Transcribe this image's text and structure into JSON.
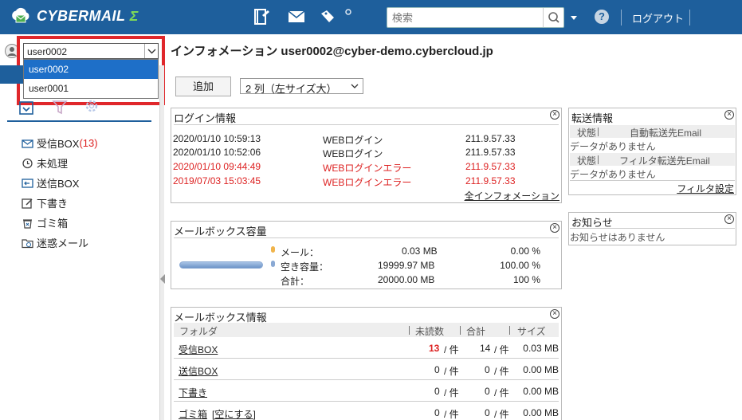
{
  "header": {
    "logo_text": "CYBERMAIL",
    "logo_sigma": "Σ",
    "search_placeholder": "検索",
    "help_label": "?",
    "logout_label": "ログアウト",
    "accent_color": "#1e5f9c"
  },
  "account": {
    "selected": "user0002",
    "options": [
      "user0002",
      "user0001"
    ]
  },
  "page_title": "インフォメーション user0002@cyber-demo.cybercloud.jp",
  "sidebar": {
    "folders": [
      {
        "label": "受信BOX",
        "count": "(13)",
        "icon": "inbox-icon"
      },
      {
        "label": "未処理",
        "count": "",
        "icon": "clock-icon"
      },
      {
        "label": "送信BOX",
        "count": "",
        "icon": "outbox-icon"
      },
      {
        "label": "下書き",
        "count": "",
        "icon": "draft-icon"
      },
      {
        "label": "ゴミ箱",
        "count": "",
        "icon": "trash-icon"
      },
      {
        "label": "迷惑メール",
        "count": "",
        "icon": "spam-folder-icon"
      }
    ]
  },
  "toolbar": {
    "add_label": "追加",
    "layout_value": "2 列（左サイズ大）"
  },
  "login_panel": {
    "title": "ログイン情報",
    "rows": [
      {
        "time": "2020/01/10 10:59:13",
        "event": "WEBログイン",
        "ip": "211.9.57.33",
        "error": false
      },
      {
        "time": "2020/01/10 10:52:06",
        "event": "WEBログイン",
        "ip": "211.9.57.33",
        "error": false
      },
      {
        "time": "2020/01/10 09:44:49",
        "event": "WEBログインエラー",
        "ip": "211.9.57.33",
        "error": true
      },
      {
        "time": "2019/07/03 15:03:45",
        "event": "WEBログインエラー",
        "ip": "211.9.57.33",
        "error": true
      }
    ],
    "all_link": "全インフォメーション"
  },
  "capacity_panel": {
    "title": "メールボックス容量",
    "used_fraction": 0.0,
    "rows": [
      {
        "label": "メール：",
        "size": "0.03 MB",
        "pct": "0.00 %",
        "dot_color": "#f0b44c"
      },
      {
        "label": "空き容量：",
        "size": "19999.97 MB",
        "pct": "100.00 %",
        "dot_color": "#8aa9d4"
      },
      {
        "label": "合計：",
        "size": "20000.00 MB",
        "pct": "100 %",
        "dot_color": ""
      }
    ]
  },
  "mailbox_panel": {
    "title": "メールボックス情報",
    "headers": {
      "folder": "フォルダ",
      "unread": "未読数",
      "total": "合計",
      "size": "サイズ"
    },
    "unit": "/ 件",
    "rows": [
      {
        "folder": "受信BOX",
        "extra": "",
        "unread": "13",
        "total": "14",
        "size": "0.03 MB",
        "unread_red": true
      },
      {
        "folder": "送信BOX",
        "extra": "",
        "unread": "0",
        "total": "0",
        "size": "0.00 MB",
        "unread_red": false
      },
      {
        "folder": "下書き",
        "extra": "",
        "unread": "0",
        "total": "0",
        "size": "0.00 MB",
        "unread_red": false
      },
      {
        "folder": "ゴミ箱",
        "extra": "[空にする]",
        "unread": "0",
        "total": "0",
        "size": "0.00 MB",
        "unread_red": false
      }
    ]
  },
  "forward_panel": {
    "title": "転送情報",
    "status_header": "状態",
    "auto_header": "自動転送先Email",
    "auto_empty": "データがありません",
    "filter_header": "フィルタ転送先Email",
    "filter_empty": "データがありません",
    "filter_link": "フィルタ設定"
  },
  "notice_panel": {
    "title": "お知らせ",
    "empty": "お知らせはありません"
  }
}
